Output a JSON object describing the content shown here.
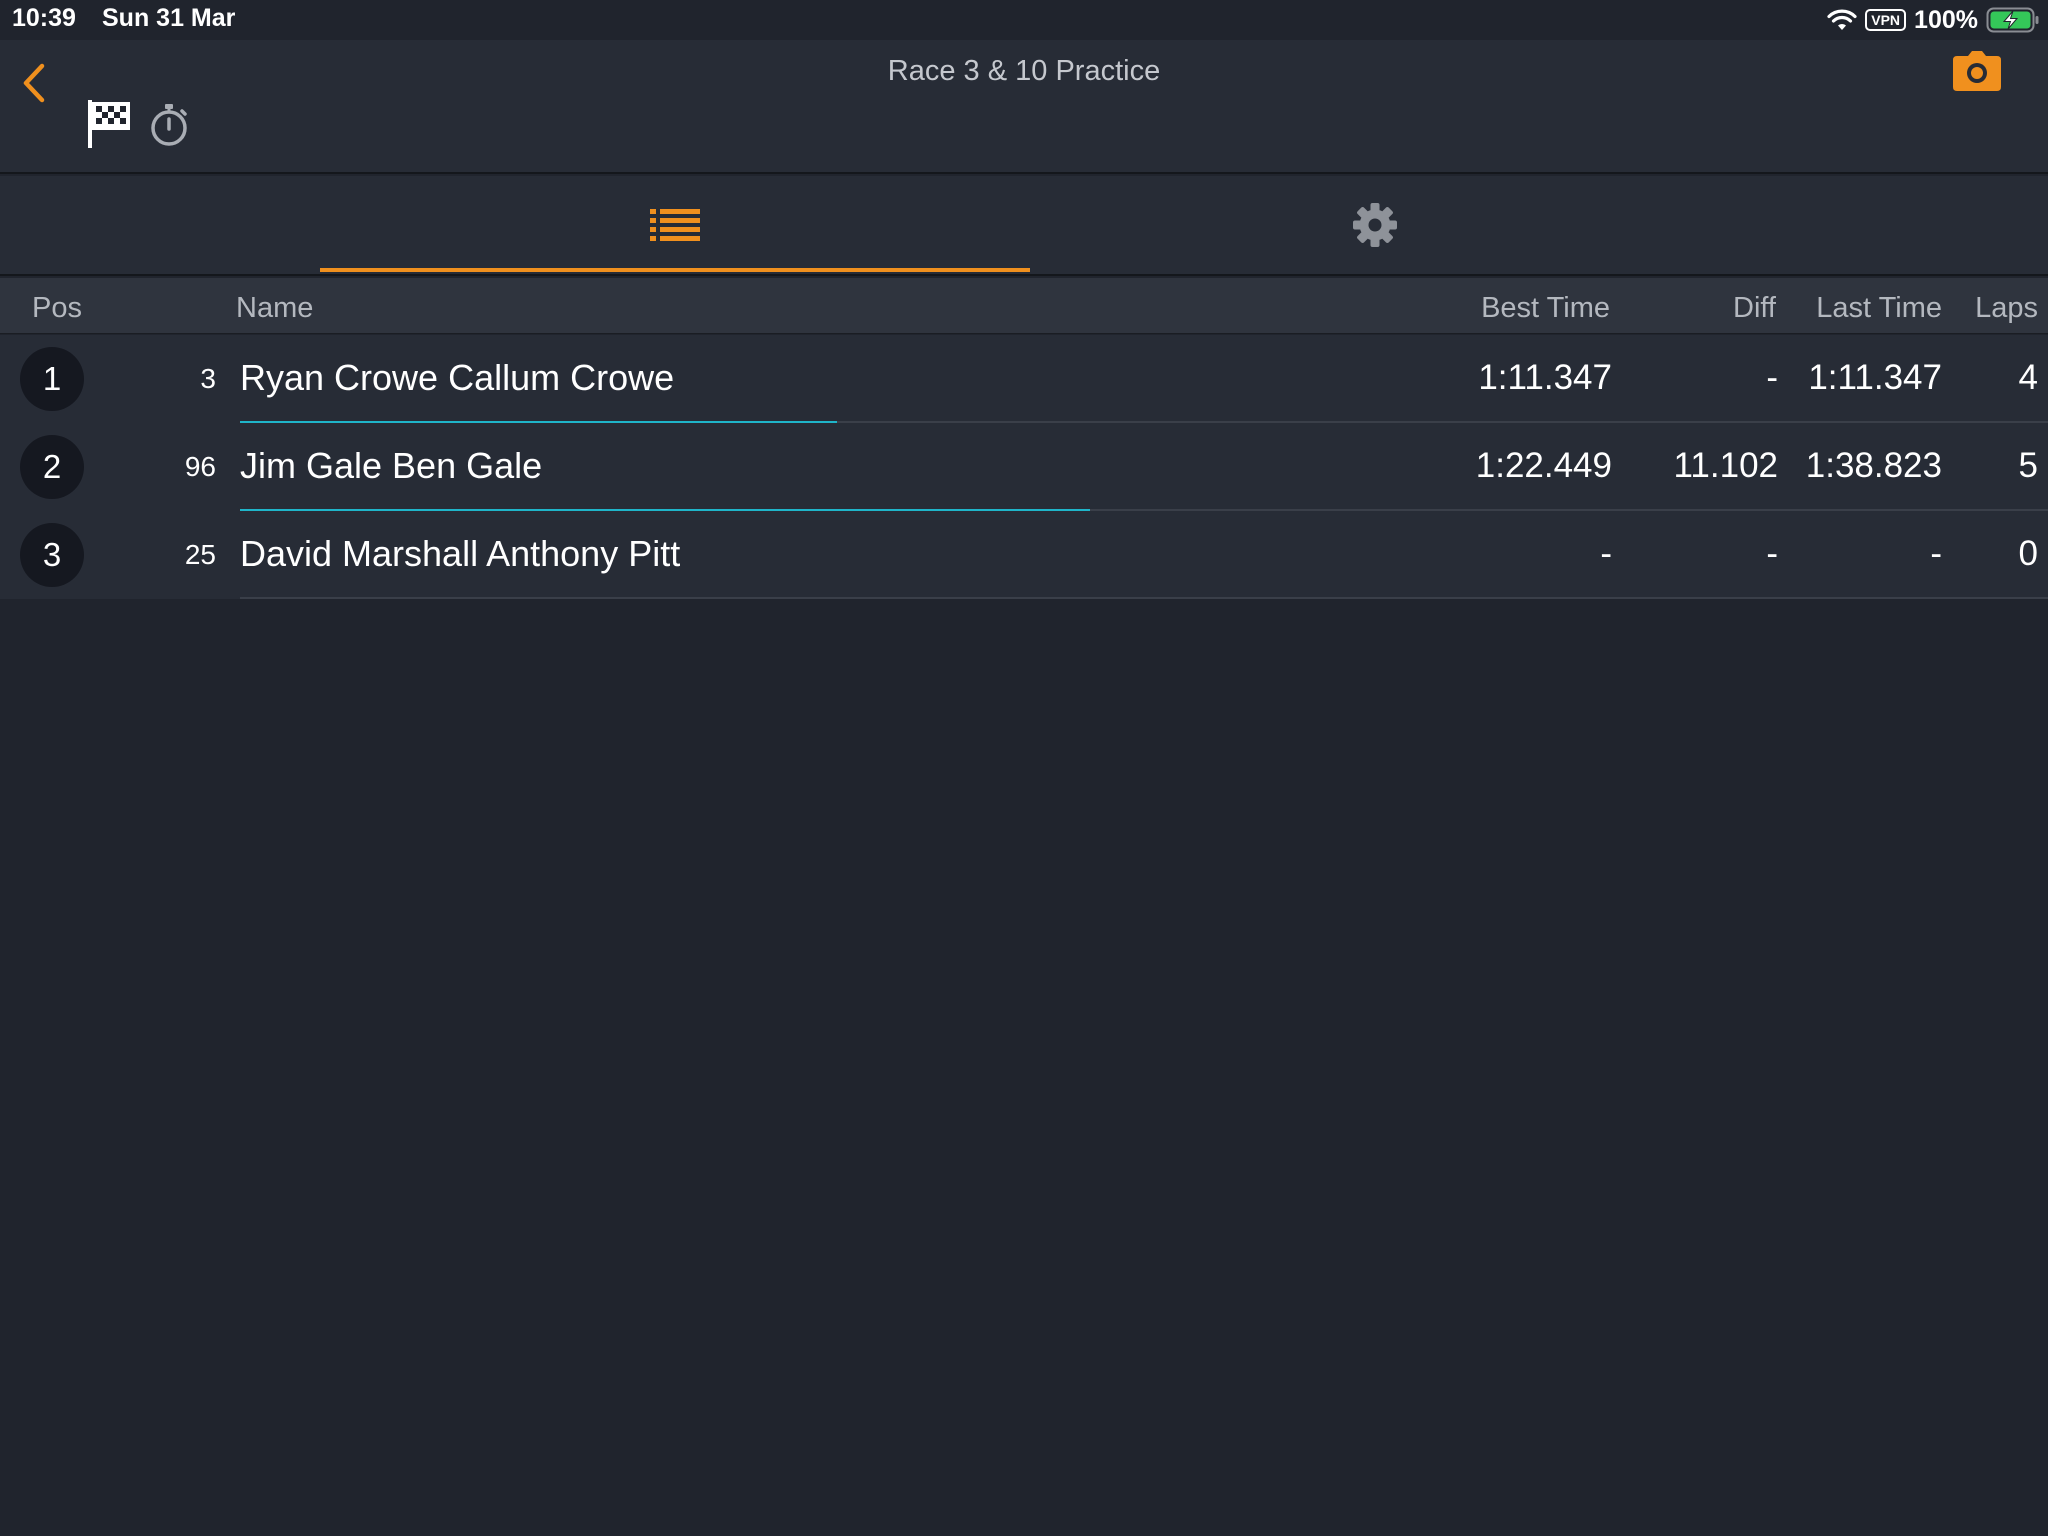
{
  "status_bar": {
    "time": "10:39",
    "date": "Sun 31 Mar",
    "vpn": "VPN",
    "battery": "100%"
  },
  "nav": {
    "title": "Race 3 & 10 Practice",
    "accent_color": "#f0901e"
  },
  "tabs": [
    {
      "icon": "list-icon",
      "selected": true
    },
    {
      "icon": "gear-icon",
      "selected": false
    }
  ],
  "table": {
    "headers": {
      "pos": "Pos",
      "name": "Name",
      "best_time": "Best Time",
      "diff": "Diff",
      "last_time": "Last Time",
      "laps": "Laps"
    },
    "rows": [
      {
        "pos": "1",
        "number": "3",
        "name": "Ryan Crowe Callum Crowe",
        "best_time": "1:11.347",
        "diff": "-",
        "last_time": "1:11.347",
        "laps": "4",
        "progress": 0.33
      },
      {
        "pos": "2",
        "number": "96",
        "name": "Jim Gale Ben Gale",
        "best_time": "1:22.449",
        "diff": "11.102",
        "last_time": "1:38.823",
        "laps": "5",
        "progress": 0.47
      },
      {
        "pos": "3",
        "number": "25",
        "name": "David Marshall Anthony Pitt",
        "best_time": "-",
        "diff": "-",
        "last_time": "-",
        "laps": "0",
        "progress": 0
      }
    ]
  }
}
